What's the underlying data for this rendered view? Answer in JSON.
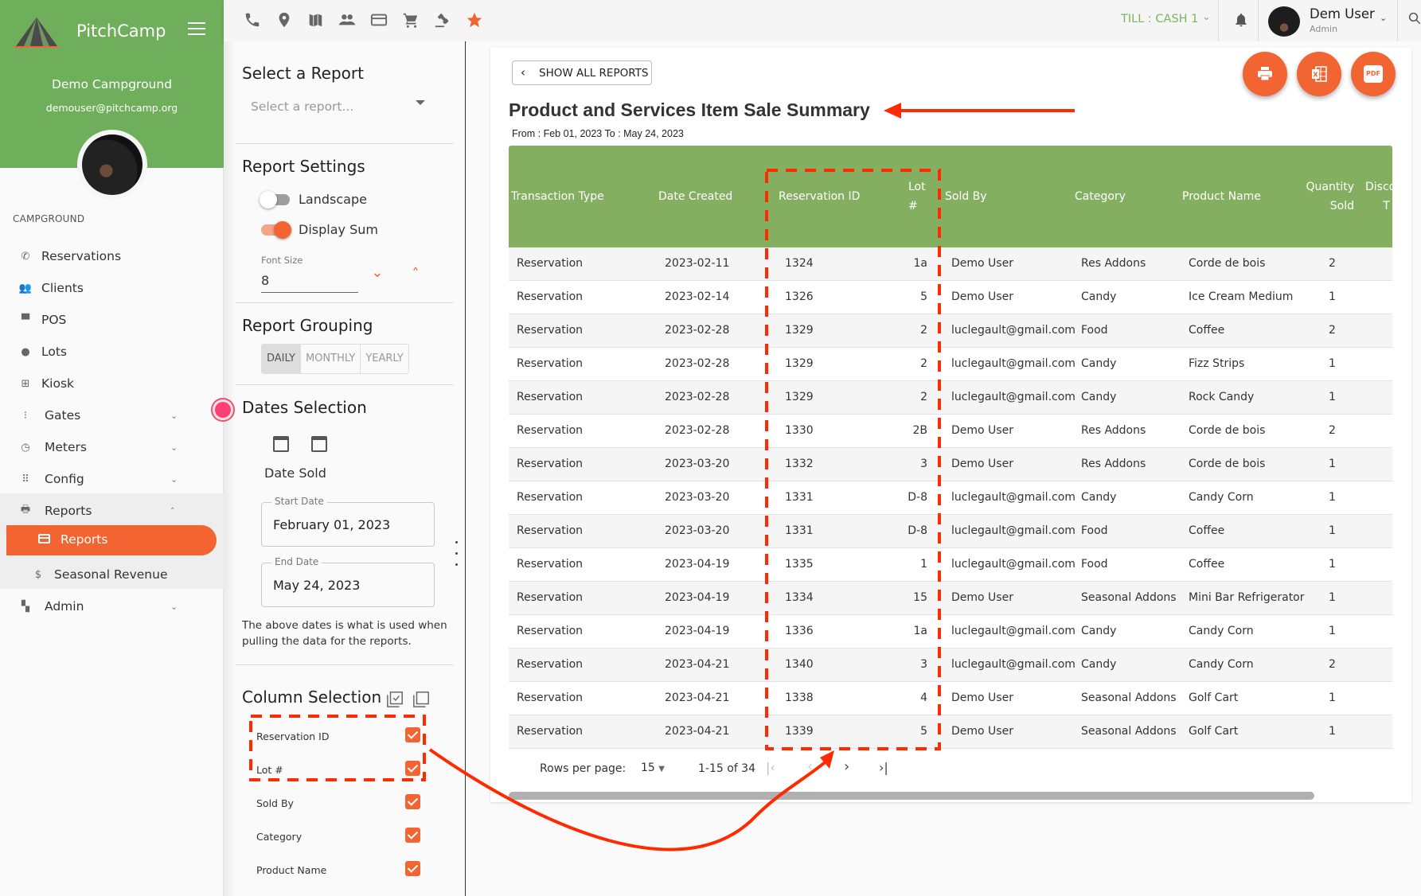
{
  "app": {
    "name": "PitchCamp",
    "campground": "Demo Campground",
    "email": "demouser@pitchcamp.org"
  },
  "sidebar": {
    "section_label": "CAMPGROUND",
    "items": [
      {
        "label": "Reservations",
        "icon": "phone-icon"
      },
      {
        "label": "Clients",
        "icon": "people-icon"
      },
      {
        "label": "POS",
        "icon": "store-icon"
      },
      {
        "label": "Lots",
        "icon": "location-pin-icon"
      },
      {
        "label": "Kiosk",
        "icon": "kiosk-icon"
      },
      {
        "label": "Gates",
        "icon": "traffic-light-icon",
        "expandable": true
      },
      {
        "label": "Meters",
        "icon": "meter-icon",
        "expandable": true
      },
      {
        "label": "Config",
        "icon": "grid-icon",
        "expandable": true
      },
      {
        "label": "Reports",
        "icon": "printer-icon",
        "expanded": true
      },
      {
        "label": "Reports",
        "icon": "card-icon",
        "active": true,
        "sub": true
      },
      {
        "label": "Seasonal Revenue",
        "icon": "dollar-icon",
        "sub": true
      },
      {
        "label": "Admin",
        "icon": "dashboard-icon",
        "expandable": true
      }
    ]
  },
  "topbar": {
    "icons": [
      "phone-icon",
      "location-pin-icon",
      "map-icon",
      "people-icon",
      "credit-card-icon",
      "cart-icon",
      "gavel-icon",
      "star-icon"
    ],
    "till": "TILL : CASH 1",
    "user_name": "Dem User",
    "user_role": "Admin",
    "accent": "#f26532",
    "till_color": "#7ab55c"
  },
  "panel": {
    "select_title": "Select a Report",
    "select_placeholder": "Select a report...",
    "settings_title": "Report Settings",
    "landscape_label": "Landscape",
    "landscape_on": false,
    "display_sum_label": "Display Sum",
    "display_sum_on": true,
    "font_size_label": "Font Size",
    "font_size": "8",
    "grouping_title": "Report Grouping",
    "grouping_options": [
      "DAILY",
      "MONTHLY",
      "YEARLY"
    ],
    "grouping_selected": "DAILY",
    "dates_title": "Dates Selection",
    "date_type": "Date Sold",
    "start_label": "Start Date",
    "start_value": "February 01, 2023",
    "end_label": "End Date",
    "end_value": "May 24, 2023",
    "date_note": "The above dates is what is used when pulling the data for the reports.",
    "columns_title": "Column Selection",
    "columns": [
      {
        "label": "Reservation ID",
        "checked": true
      },
      {
        "label": "Lot #",
        "checked": true
      },
      {
        "label": "Sold By",
        "checked": true
      },
      {
        "label": "Category",
        "checked": true
      },
      {
        "label": "Product Name",
        "checked": true
      }
    ]
  },
  "report": {
    "back_label": "SHOW ALL REPORTS",
    "title": "Product and Services Item Sale Summary",
    "range": "From : Feb 01, 2023 To : May 24, 2023",
    "actions": [
      "print-icon",
      "excel-icon",
      "pdf-icon"
    ],
    "pdf_label": "PDF",
    "header_color": "#84af61",
    "columns": [
      "Transaction Type",
      "Date Created",
      "Reservation ID",
      "Lot #",
      "Sold By",
      "Category",
      "Product Name",
      "Quantity Sold",
      "Discount T"
    ],
    "rows": [
      [
        "Reservation",
        "2023-02-11",
        "1324",
        "1a",
        "Demo User",
        "Res Addons",
        "Corde de bois",
        "2"
      ],
      [
        "Reservation",
        "2023-02-14",
        "1326",
        "5",
        "Demo User",
        "Candy",
        "Ice Cream Medium",
        "1"
      ],
      [
        "Reservation",
        "2023-02-28",
        "1329",
        "2",
        "luclegault@gmail.com",
        "Food",
        "Coffee",
        "2"
      ],
      [
        "Reservation",
        "2023-02-28",
        "1329",
        "2",
        "luclegault@gmail.com",
        "Candy",
        "Fizz Strips",
        "1"
      ],
      [
        "Reservation",
        "2023-02-28",
        "1329",
        "2",
        "luclegault@gmail.com",
        "Candy",
        "Rock Candy",
        "1"
      ],
      [
        "Reservation",
        "2023-02-28",
        "1330",
        "2B",
        "Demo User",
        "Res Addons",
        "Corde de bois",
        "2"
      ],
      [
        "Reservation",
        "2023-03-20",
        "1332",
        "3",
        "Demo User",
        "Res Addons",
        "Corde de bois",
        "1"
      ],
      [
        "Reservation",
        "2023-03-20",
        "1331",
        "D-8",
        "luclegault@gmail.com",
        "Candy",
        "Candy Corn",
        "1"
      ],
      [
        "Reservation",
        "2023-03-20",
        "1331",
        "D-8",
        "luclegault@gmail.com",
        "Food",
        "Coffee",
        "1"
      ],
      [
        "Reservation",
        "2023-04-19",
        "1335",
        "1",
        "luclegault@gmail.com",
        "Food",
        "Coffee",
        "1"
      ],
      [
        "Reservation",
        "2023-04-19",
        "1334",
        "15",
        "Demo User",
        "Seasonal Addons",
        "Mini Bar Refrigerator",
        "1"
      ],
      [
        "Reservation",
        "2023-04-19",
        "1336",
        "1a",
        "luclegault@gmail.com",
        "Candy",
        "Candy Corn",
        "1"
      ],
      [
        "Reservation",
        "2023-04-21",
        "1340",
        "3",
        "luclegault@gmail.com",
        "Candy",
        "Candy Corn",
        "2"
      ],
      [
        "Reservation",
        "2023-04-21",
        "1338",
        "4",
        "Demo User",
        "Seasonal Addons",
        "Golf Cart",
        "1"
      ],
      [
        "Reservation",
        "2023-04-21",
        "1339",
        "5",
        "Demo User",
        "Seasonal Addons",
        "Golf Cart",
        "1"
      ]
    ],
    "pagination": {
      "rows_per_page_label": "Rows per page:",
      "rows_per_page": "15",
      "range": "1-15 of 34"
    }
  },
  "annotations": {
    "color": "#ff2a00"
  }
}
